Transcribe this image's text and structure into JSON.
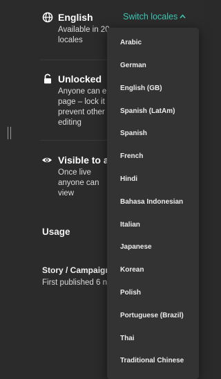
{
  "locale": {
    "icon": "globe-icon",
    "title": "English",
    "description_line1": "Available in 20",
    "description_line2": "locales",
    "switch_label": "Switch locales",
    "switch_icon": "chevron-up-icon",
    "accent_color": "#3ec5b4"
  },
  "lock": {
    "icon": "unlocked-padlock-icon",
    "title": "Unlocked",
    "description_line1": "Anyone can e",
    "description_line2": "page – lock it",
    "description_line3": "prevent other",
    "description_line4": "editing"
  },
  "visibility": {
    "icon": "eye-icon",
    "title": "Visible to al",
    "description_line1": "Once live",
    "description_line2": "anyone can",
    "description_line3": "view"
  },
  "usage": {
    "heading": "Usage"
  },
  "story": {
    "title": "Story / Campaign",
    "meta": "First published 6 n"
  },
  "locale_dropdown": {
    "items": [
      "Arabic",
      "German",
      "English (GB)",
      "Spanish (LatAm)",
      "Spanish",
      "French",
      "Hindi",
      "Bahasa Indonesian",
      "Italian",
      "Japanese",
      "Korean",
      "Polish",
      "Portuguese (Brazil)",
      "Thai",
      "Traditional Chinese"
    ]
  }
}
